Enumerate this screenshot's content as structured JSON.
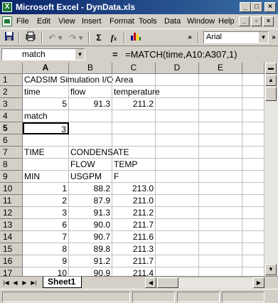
{
  "window": {
    "title": "Microsoft Excel - DynData.xls"
  },
  "menu": [
    "File",
    "Edit",
    "View",
    "Insert",
    "Format",
    "Tools",
    "Data",
    "Window",
    "Help"
  ],
  "toolbar": {
    "font": "Arial"
  },
  "formula_bar": {
    "name_box": "match",
    "formula": "=MATCH(time,A10:A307,1)"
  },
  "columns": [
    "A",
    "B",
    "C",
    "D",
    "E"
  ],
  "selected_column": "A",
  "selected_row": "5",
  "rows": [
    {
      "n": "1",
      "a": "CADSIM Simulation I/O Area",
      "b": "",
      "c": ""
    },
    {
      "n": "2",
      "a": "time",
      "b": "flow",
      "c": "temperature"
    },
    {
      "n": "3",
      "a": "5",
      "b": "91.3",
      "c": "211.2"
    },
    {
      "n": "4",
      "a": "match",
      "b": "",
      "c": ""
    },
    {
      "n": "5",
      "a": "3",
      "b": "",
      "c": ""
    },
    {
      "n": "6",
      "a": "",
      "b": "",
      "c": ""
    },
    {
      "n": "7",
      "a": "TIME",
      "b": "CONDENSATE",
      "c": ""
    },
    {
      "n": "8",
      "a": "",
      "b": "FLOW",
      "c": "TEMP"
    },
    {
      "n": "9",
      "a": "MIN",
      "b": "USGPM",
      "c": "F"
    },
    {
      "n": "10",
      "a": "1",
      "b": "88.2",
      "c": "213.0"
    },
    {
      "n": "11",
      "a": "2",
      "b": "87.9",
      "c": "211.0"
    },
    {
      "n": "12",
      "a": "3",
      "b": "91.3",
      "c": "211.2"
    },
    {
      "n": "13",
      "a": "6",
      "b": "90.0",
      "c": "211.7"
    },
    {
      "n": "14",
      "a": "7",
      "b": "90.7",
      "c": "211.6"
    },
    {
      "n": "15",
      "a": "8",
      "b": "89.8",
      "c": "211.3"
    },
    {
      "n": "16",
      "a": "9",
      "b": "91.2",
      "c": "211.7"
    },
    {
      "n": "17",
      "a": "10",
      "b": "90.9",
      "c": "211.4"
    }
  ],
  "sheet_tab": "Sheet1"
}
